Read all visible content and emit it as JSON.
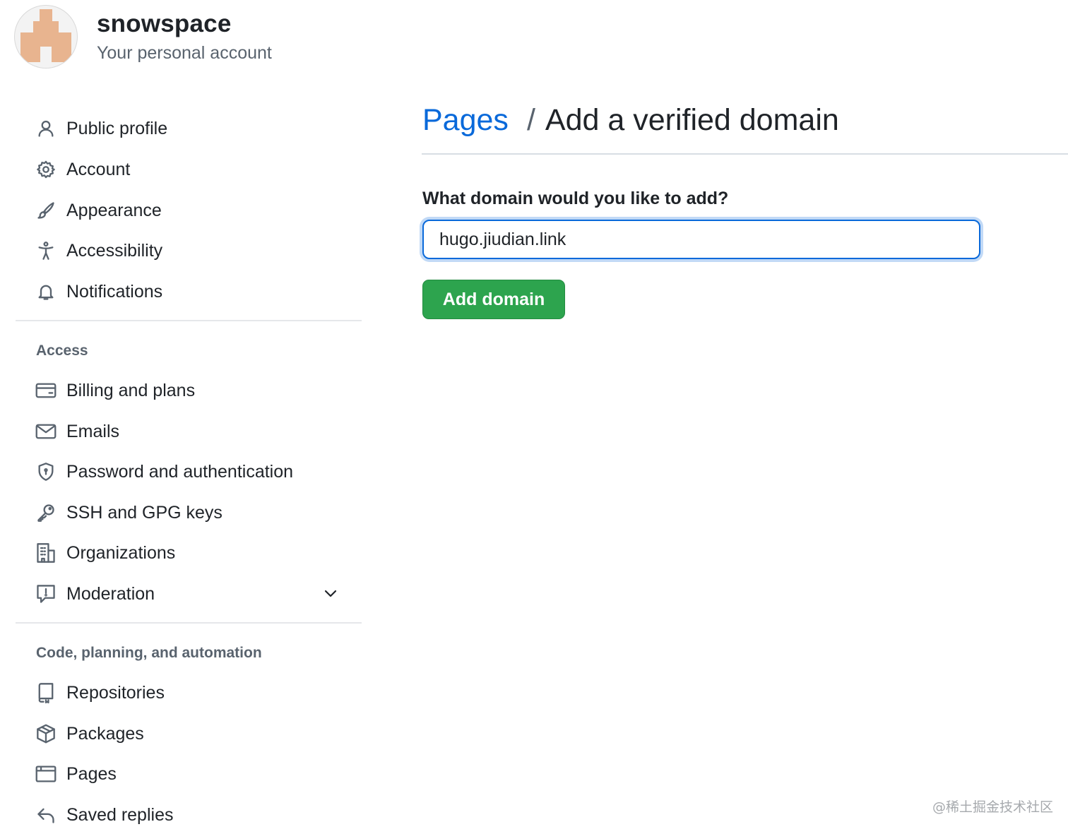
{
  "header": {
    "username": "snowspace",
    "account_type": "Your personal account"
  },
  "sidebar": {
    "group1": [
      {
        "label": "Public profile",
        "icon": "person-icon"
      },
      {
        "label": "Account",
        "icon": "gear-icon"
      },
      {
        "label": "Appearance",
        "icon": "paintbrush-icon"
      },
      {
        "label": "Accessibility",
        "icon": "accessibility-icon"
      },
      {
        "label": "Notifications",
        "icon": "bell-icon"
      }
    ],
    "access_title": "Access",
    "access": [
      {
        "label": "Billing and plans",
        "icon": "credit-card-icon"
      },
      {
        "label": "Emails",
        "icon": "mail-icon"
      },
      {
        "label": "Password and authentication",
        "icon": "shield-lock-icon"
      },
      {
        "label": "SSH and GPG keys",
        "icon": "key-icon"
      },
      {
        "label": "Organizations",
        "icon": "organization-icon"
      },
      {
        "label": "Moderation",
        "icon": "report-icon"
      }
    ],
    "code_title": "Code, planning, and automation",
    "code": [
      {
        "label": "Repositories",
        "icon": "repo-icon"
      },
      {
        "label": "Packages",
        "icon": "package-icon"
      },
      {
        "label": "Pages",
        "icon": "browser-icon"
      },
      {
        "label": "Saved replies",
        "icon": "reply-icon"
      }
    ]
  },
  "main": {
    "breadcrumb_link": "Pages",
    "breadcrumb_separator": "/",
    "breadcrumb_current": "Add a verified domain",
    "field_label": "What domain would you like to add?",
    "domain_value": "hugo.jiudian.link",
    "submit_label": "Add domain"
  },
  "watermark": "@稀土掘金技术社区",
  "colors": {
    "link": "#0969da",
    "primary_button": "#2da44e",
    "focus_ring": "#0969da",
    "avatar": "#e8b48f"
  }
}
